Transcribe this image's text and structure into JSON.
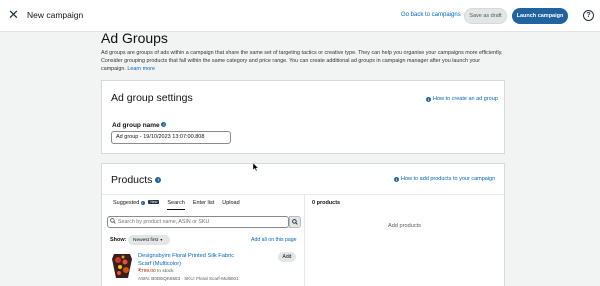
{
  "topbar": {
    "title": "New campaign",
    "back_link": "Go back to campaigns",
    "save_draft": "Save as draft",
    "launch": "Launch campaign",
    "help_glyph": "?",
    "close_glyph": "✕"
  },
  "page": {
    "heading": "Ad Groups",
    "intro": "Ad groups are groups of ads within a campaign that share the same set of targeting tactics or creative type. They can help you organise your campaigns more efficiently. Consider grouping products that fall within the same category and price range. You can create additional ad groups in campaign manager after you launch your campaign.",
    "learn_more": "Learn more"
  },
  "settings": {
    "title": "Ad group settings",
    "help_link": "How to create an ad group",
    "name_label": "Ad group name",
    "name_value": "Ad group - 19/10/2023 13:07:00.808"
  },
  "products": {
    "title": "Products",
    "help_link": "How to add products to your campaign",
    "tabs": [
      {
        "label": "Suggested",
        "badge": "New"
      },
      {
        "label": "Search"
      },
      {
        "label": "Enter list"
      },
      {
        "label": "Upload"
      }
    ],
    "search_placeholder": "Search by product name, ASIN or SKU",
    "show_label": "Show:",
    "sort_value": "Newest first",
    "add_all": "Add all on this page",
    "item": {
      "title": "Designsbyim Floral Printed Silk Fabric Scarf (Multicolor)",
      "price": "₹799.00",
      "stock": "In stock",
      "meta": "ASIN: B0DEQK8583 · SKU: Floral Scarf-Multi001",
      "add_label": "Add"
    },
    "count": "0 products",
    "empty_text": "Add products"
  },
  "colors": {
    "primary": "#2162a1",
    "link": "#0066c0",
    "price": "#b12704"
  },
  "icons": {
    "info": "info-icon",
    "search": "search-icon",
    "help": "help-icon",
    "close": "close-icon"
  }
}
